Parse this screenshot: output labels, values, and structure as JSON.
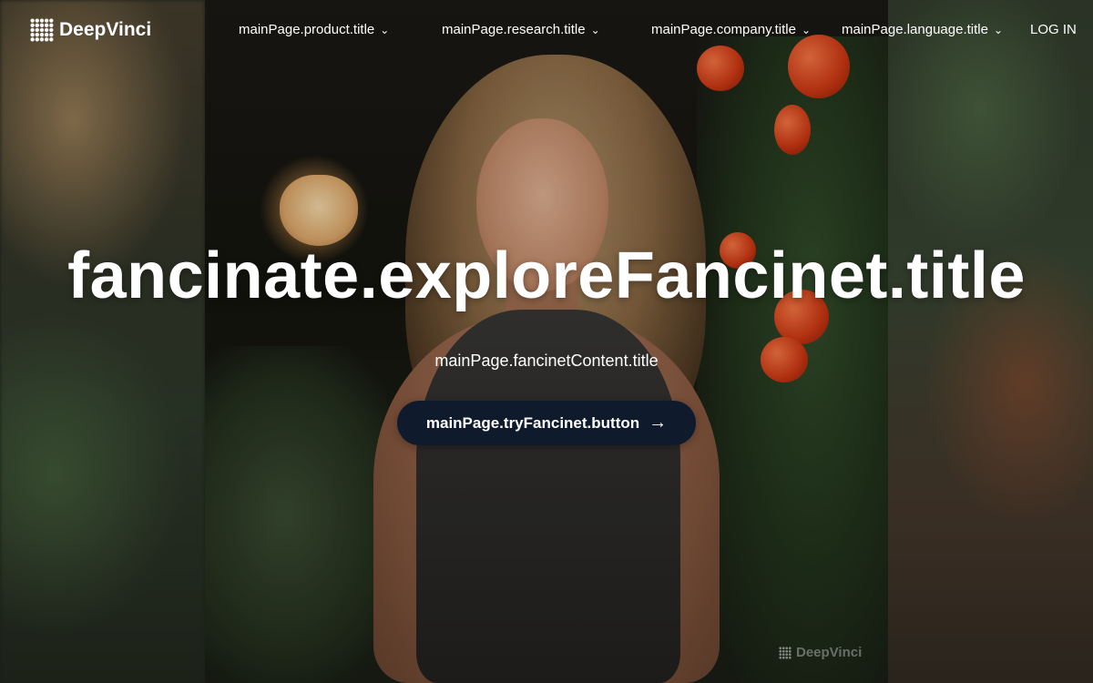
{
  "brand": {
    "name": "DeepVinci",
    "logo_icon": "dot-grid-icon"
  },
  "nav": {
    "items": [
      {
        "label": "mainPage.product.title"
      },
      {
        "label": "mainPage.research.title"
      },
      {
        "label": "mainPage.company.title"
      },
      {
        "label": "mainPage.language.title"
      }
    ],
    "login_label": "LOG IN"
  },
  "hero": {
    "title": "fancinate.exploreFancinet.title",
    "subtitle": "mainPage.fancinetContent.title",
    "cta_label": "mainPage.tryFancinet.button",
    "cta_icon": "arrow-right-icon"
  },
  "watermark": {
    "text": "DeepVinci"
  },
  "colors": {
    "cta_background": "#0f1a2c",
    "text": "#ffffff"
  }
}
